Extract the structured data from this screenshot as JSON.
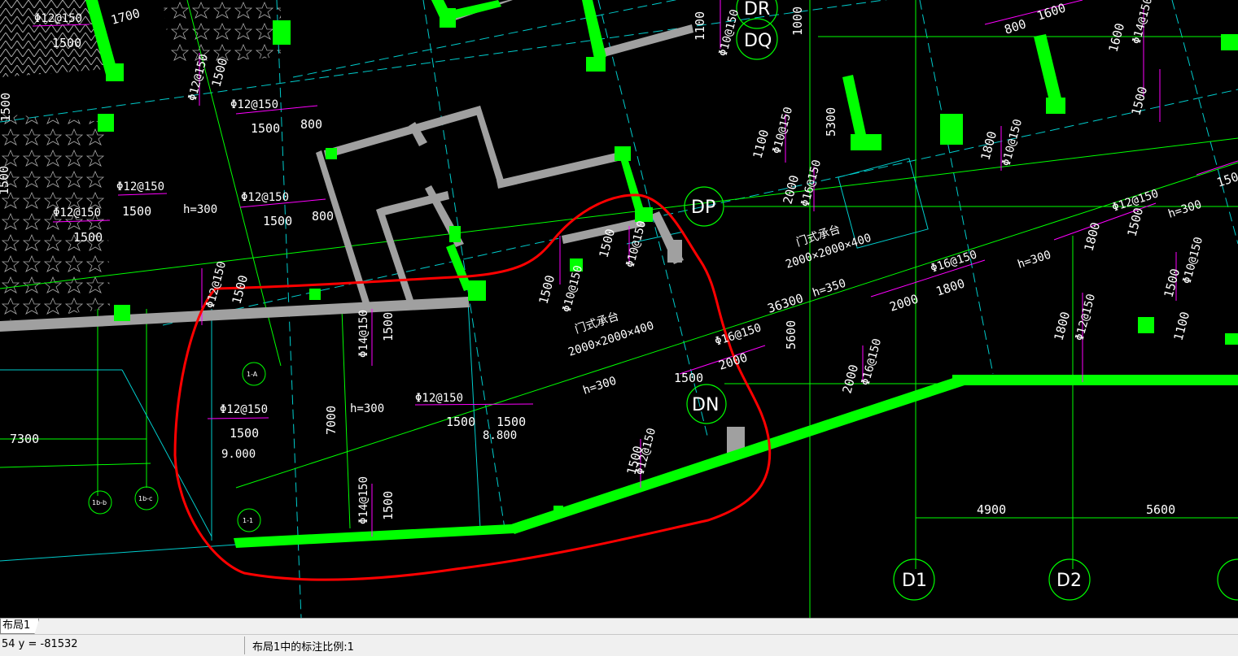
{
  "drawing": {
    "axis_labels": [
      "DR",
      "DQ",
      "DP",
      "DN",
      "D1",
      "D2"
    ],
    "dimensions": {
      "d1700": "1700",
      "d1500": "1500",
      "d800": "800",
      "d7300": "7300",
      "d7000": "7000",
      "d36300": "36300",
      "d2000": "2000",
      "d1800": "1800",
      "d1600": "1600",
      "d5300": "5300",
      "d5600": "5600",
      "d4900": "4900",
      "d1100": "1100",
      "d1000": "1000"
    },
    "rebar": {
      "phi12": "Φ12@150",
      "phi14": "Φ14@150",
      "phi16": "Φ16@150",
      "phi10": "Φ10@150"
    },
    "heights": {
      "h300": "h=300",
      "h350": "h=350"
    },
    "elevations": {
      "e9000": "9.000",
      "e8800": "8.800"
    },
    "cap_labels": {
      "cap_name": "门式承台",
      "cap_size": "2000×2000×400"
    },
    "section_marks": [
      "1-A",
      "1-1",
      "1b-b",
      "1b-c"
    ]
  },
  "tab": {
    "label": "布局1"
  },
  "status": {
    "coord": "54 y = -81532",
    "scale_note": "布局1中的标注比例:1"
  },
  "colors": {
    "background": "#000000",
    "wall": "#00ff00",
    "slab_wall": "#a0a0a0",
    "dim_line": "#00ff00",
    "rebar_line": "#ff00ff",
    "axis_line": "#00cccc",
    "highlight": "#ff0000"
  }
}
